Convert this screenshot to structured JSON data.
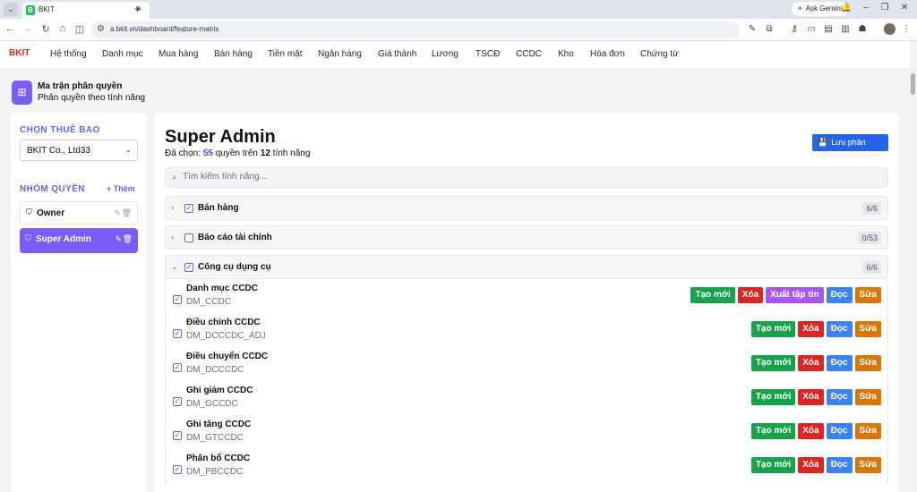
{
  "browser": {
    "tab_title": "BKIT",
    "tab_favicon": "B",
    "url": "a.bkit.vn/dashboard/feature-matrix",
    "ask_gemini": "Ask Gemini"
  },
  "app": {
    "brand": "BKIT",
    "menu": [
      "Hệ thống",
      "Danh mục",
      "Mua hàng",
      "Bán hàng",
      "Tiền mặt",
      "Ngân hàng",
      "Giá thành",
      "Lương",
      "TSCĐ",
      "CCDC",
      "Kho",
      "Hóa đơn",
      "Chứng từ"
    ]
  },
  "page": {
    "title": "Ma trận phân quyền",
    "subtitle": "Phân quyền theo tính năng"
  },
  "sidebar": {
    "tenant_label": "CHỌN THUÊ BAO",
    "tenant_value": "BKIT Co., Ltd33",
    "groups_label": "NHÓM QUYỀN",
    "add_label": "+ Thêm",
    "roles": [
      {
        "name": "Owner",
        "active": false
      },
      {
        "name": "Super Admin",
        "active": true
      }
    ]
  },
  "main": {
    "title": "Super Admin",
    "selected_prefix": "Đã chọn:",
    "selected_count": "55",
    "selected_mid": "quyền trên",
    "feature_count": "12",
    "selected_suffix": "tính năng",
    "save_label": "Lưu phân quyền",
    "search_placeholder": "Tìm kiếm tính năng...",
    "groups": [
      {
        "name": "Bán hàng",
        "count": "6/6",
        "checked": true,
        "expanded": false
      },
      {
        "name": "Báo cáo tài chính",
        "count": "0/53",
        "checked": false,
        "expanded": false
      },
      {
        "name": "Công cụ dụng cụ",
        "count": "6/6",
        "checked": true,
        "expanded": true
      }
    ],
    "features": [
      {
        "name": "Danh mục CCDC",
        "code": "DM_CCDC",
        "actions": [
          "Tạo mới",
          "Xóa",
          "Xuất tập tin",
          "Đọc",
          "Sửa"
        ]
      },
      {
        "name": "Điều chỉnh CCDC",
        "code": "DM_DCCCDC_ADJ",
        "actions": [
          "Tạo mới",
          "Xóa",
          "Đọc",
          "Sửa"
        ]
      },
      {
        "name": "Điều chuyển CCDC",
        "code": "DM_DCCCDC",
        "actions": [
          "Tạo mới",
          "Xóa",
          "Đọc",
          "Sửa"
        ]
      },
      {
        "name": "Ghi giảm CCDC",
        "code": "DM_GCCDC",
        "actions": [
          "Tạo mới",
          "Xóa",
          "Đọc",
          "Sửa"
        ]
      },
      {
        "name": "Ghi tăng CCDC",
        "code": "DM_GTCCDC",
        "actions": [
          "Tạo mới",
          "Xóa",
          "Đọc",
          "Sửa"
        ]
      },
      {
        "name": "Phân bổ CCDC",
        "code": "DM_PBCCDC",
        "actions": [
          "Tạo mới",
          "Xóa",
          "Đọc",
          "Sửa"
        ]
      }
    ]
  },
  "colors": {
    "accent": "#7c5cf6",
    "primary_button": "#2563eb",
    "create": "#16a34a",
    "delete": "#dc2626",
    "export": "#a855f7",
    "read": "#3b82f6",
    "edit": "#d97706"
  },
  "icons": {
    "page_icon": "grid-icon",
    "search": "search-icon",
    "save": "save-icon",
    "role": "shield-icon",
    "edit": "pencil-icon",
    "delete": "trash-icon"
  }
}
